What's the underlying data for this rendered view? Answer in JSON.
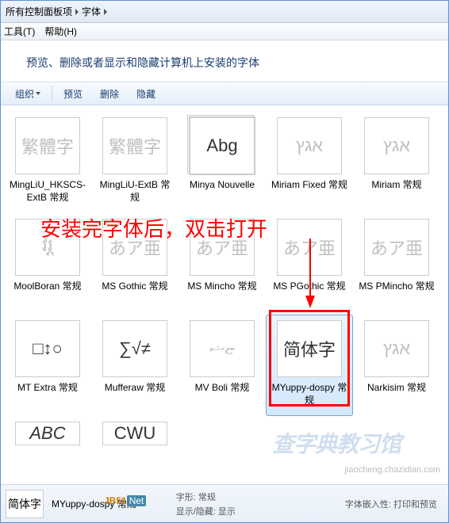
{
  "breadcrumb": {
    "item1": "所有控制面板项",
    "item2": "字体"
  },
  "menu": {
    "tools": "工具(T)",
    "help": "帮助(H)"
  },
  "header": {
    "title": "预览、删除或者显示和隐藏计算机上安装的字体"
  },
  "toolbar": {
    "organize": "组织",
    "preview": "预览",
    "delete": "删除",
    "hide": "隐藏"
  },
  "fonts": [
    {
      "name": "MingLiU_HKSCS-ExtB 常规",
      "sample": "繁體字",
      "dim": true,
      "stack": false
    },
    {
      "name": "MingLiU-ExtB 常规",
      "sample": "繁體字",
      "dim": true,
      "stack": false
    },
    {
      "name": "Minya Nouvelle",
      "sample": "Abg",
      "dim": false,
      "stack": true
    },
    {
      "name": "Miriam Fixed 常规",
      "sample": "אגץ",
      "dim": true,
      "stack": false
    },
    {
      "name": "Miriam 常规",
      "sample": "אגץ",
      "dim": true,
      "stack": false
    },
    {
      "name": "MoolBoran 常规",
      "sample": "វរ្ត",
      "dim": true,
      "stack": false
    },
    {
      "name": "MS Gothic 常规",
      "sample": "あア亜",
      "dim": true,
      "stack": false
    },
    {
      "name": "MS Mincho 常规",
      "sample": "あア亜",
      "dim": true,
      "stack": false
    },
    {
      "name": "MS PGothic 常规",
      "sample": "あア亜",
      "dim": true,
      "stack": false
    },
    {
      "name": "MS PMincho 常规",
      "sample": "あア亜",
      "dim": true,
      "stack": false
    },
    {
      "name": "MT Extra 常规",
      "sample": "□↕○",
      "dim": false,
      "stack": false
    },
    {
      "name": "Mufferaw 常规",
      "sample": "∑√≠",
      "dim": false,
      "stack": false
    },
    {
      "name": "MV Boli 常规",
      "sample": "ޏޟ",
      "dim": true,
      "stack": false
    },
    {
      "name": "MYuppy-dospy 常规",
      "sample": "简体字",
      "dim": false,
      "stack": false,
      "selected": true
    },
    {
      "name": "Narkisim 常规",
      "sample": "אגץ",
      "dim": true,
      "stack": false
    }
  ],
  "partial_row": [
    {
      "sample": "ABC",
      "style": "italic"
    },
    {
      "sample": "CWU"
    }
  ],
  "annotation": {
    "text": "安装完字体后，双击打开"
  },
  "status": {
    "preview_sample": "简体字",
    "name": "MYuppy-dospy 常规",
    "style_label": "字形:",
    "style_value": "常规",
    "show_hide": "显示/隐藏:",
    "show_hide_value": "显示",
    "embed_label": "字体嵌入性:",
    "embed_value": "打印和预览"
  },
  "watermarks": {
    "text1": "jiaocheng.chazidian.com",
    "text2": "查字典教习馆",
    "jb": "JB51",
    "net": "Net"
  }
}
